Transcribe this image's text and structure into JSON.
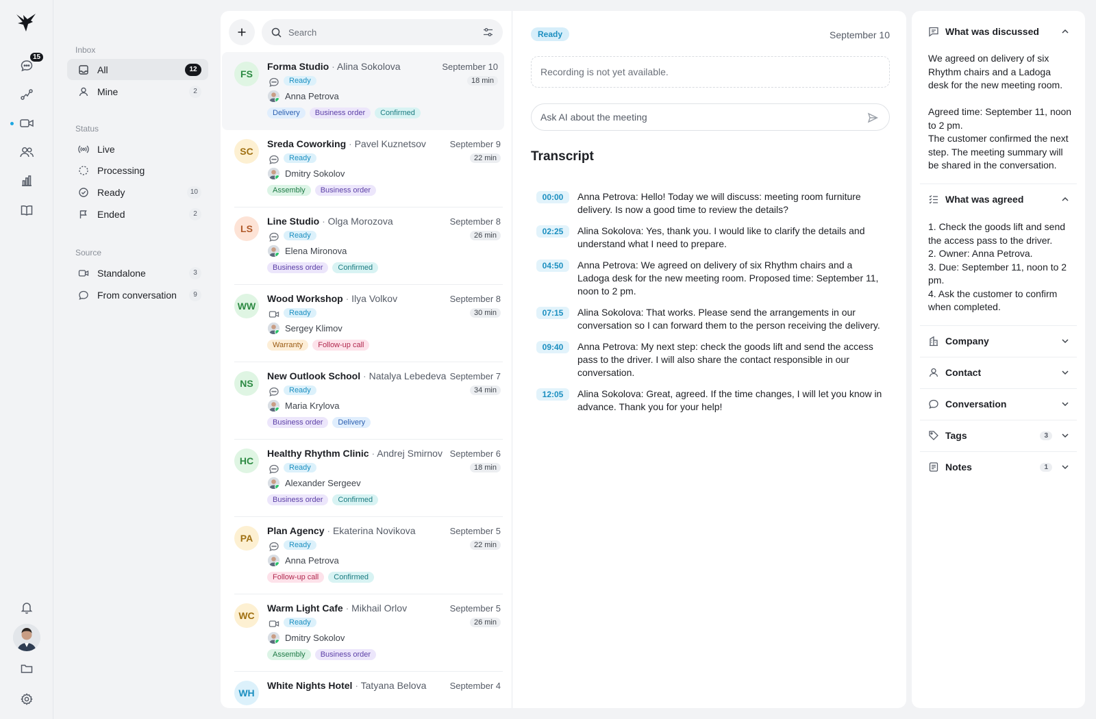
{
  "rail": {
    "chat_badge": "15"
  },
  "filters": {
    "inbox_title": "Inbox",
    "status_title": "Status",
    "source_title": "Source",
    "inbox": [
      {
        "label": "All",
        "count": "12"
      },
      {
        "label": "Mine",
        "count": "2"
      }
    ],
    "status": [
      {
        "label": "Live",
        "count": ""
      },
      {
        "label": "Processing",
        "count": ""
      },
      {
        "label": "Ready",
        "count": "10"
      },
      {
        "label": "Ended",
        "count": "2"
      }
    ],
    "source": [
      {
        "label": "Standalone",
        "count": "3"
      },
      {
        "label": "From conversation",
        "count": "9"
      }
    ]
  },
  "search": {
    "placeholder": "Search"
  },
  "meetings": [
    {
      "initials": "FS",
      "company": "Forma Studio",
      "contact": "Alina Sokolova",
      "date": "September 10",
      "duration": "18 min",
      "status": "Ready",
      "agent": "Anna Petrova",
      "source": "chat",
      "tags": [
        "Delivery",
        "Business order",
        "Confirmed"
      ]
    },
    {
      "initials": "SC",
      "company": "Sreda Coworking",
      "contact": "Pavel Kuznetsov",
      "date": "September 9",
      "duration": "22 min",
      "status": "Ready",
      "agent": "Dmitry Sokolov",
      "source": "chat",
      "tags": [
        "Assembly",
        "Business order"
      ]
    },
    {
      "initials": "LS",
      "company": "Line Studio",
      "contact": "Olga Morozova",
      "date": "September 8",
      "duration": "26 min",
      "status": "Ready",
      "agent": "Elena Mironova",
      "source": "chat",
      "tags": [
        "Business order",
        "Confirmed"
      ]
    },
    {
      "initials": "WW",
      "company": "Wood Workshop",
      "contact": "Ilya Volkov",
      "date": "September 8",
      "duration": "30 min",
      "status": "Ready",
      "agent": "Sergey Klimov",
      "source": "video",
      "tags": [
        "Warranty",
        "Follow-up call"
      ]
    },
    {
      "initials": "NS",
      "company": "New Outlook School",
      "contact": "Natalya Lebedeva",
      "date": "September 7",
      "duration": "34 min",
      "status": "Ready",
      "agent": "Maria Krylova",
      "source": "chat",
      "tags": [
        "Business order",
        "Delivery"
      ]
    },
    {
      "initials": "HC",
      "company": "Healthy Rhythm Clinic",
      "contact": "Andrej Smirnov",
      "date": "September 6",
      "duration": "18 min",
      "status": "Ready",
      "agent": "Alexander Sergeev",
      "source": "chat",
      "tags": [
        "Business order",
        "Confirmed"
      ]
    },
    {
      "initials": "PA",
      "company": "Plan Agency",
      "contact": "Ekaterina Novikova",
      "date": "September 5",
      "duration": "22 min",
      "status": "Ready",
      "agent": "Anna Petrova",
      "source": "chat",
      "tags": [
        "Follow-up call",
        "Confirmed"
      ]
    },
    {
      "initials": "WC",
      "company": "Warm Light Cafe",
      "contact": "Mikhail Orlov",
      "date": "September 5",
      "duration": "26 min",
      "status": "Ready",
      "agent": "Dmitry Sokolov",
      "source": "video",
      "tags": [
        "Assembly",
        "Business order"
      ]
    },
    {
      "initials": "WH",
      "company": "White Nights Hotel",
      "contact": "Tatyana Belova",
      "date": "September 4",
      "duration": "",
      "status": "",
      "agent": "",
      "source": "",
      "tags": []
    }
  ],
  "detail": {
    "status": "Ready",
    "date": "September 10",
    "recording_note": "Recording is not yet available.",
    "ask_placeholder": "Ask AI about the meeting",
    "transcript_title": "Transcript",
    "transcript": [
      {
        "time": "00:00",
        "text": "Anna Petrova: Hello! Today we will discuss: meeting room furniture delivery. Is now a good time to review the details?"
      },
      {
        "time": "02:25",
        "text": "Alina Sokolova: Yes, thank you. I would like to clarify the details and understand what I need to prepare."
      },
      {
        "time": "04:50",
        "text": "Anna Petrova: We agreed on delivery of six Rhythm chairs and a Ladoga desk for the new meeting room. Proposed time: September 11, noon to 2 pm."
      },
      {
        "time": "07:15",
        "text": "Alina Sokolova: That works. Please send the arrangements in our conversation so I can forward them to the person receiving the delivery."
      },
      {
        "time": "09:40",
        "text": "Anna Petrova: My next step: check the goods lift and send the access pass to the driver. I will also share the contact responsible in our conversation."
      },
      {
        "time": "12:05",
        "text": "Alina Sokolova: Great, agreed. If the time changes, I will let you know in advance. Thank you for your help!"
      }
    ]
  },
  "side": {
    "discussed_title": "What was discussed",
    "discussed_body": "We agreed on delivery of six Rhythm chairs and a Ladoga desk for the new meeting room.\n\nAgreed time: September 11, noon to 2 pm.\nThe customer confirmed the next step. The meeting summary will be shared in the conversation.",
    "agreed_title": "What was agreed",
    "agreed_body": "1. Check the goods lift and send the access pass to the driver.\n2. Owner: Anna Petrova.\n3. Due: September 11, noon to 2 pm.\n4. Ask the customer to confirm when completed.",
    "company_title": "Company",
    "contact_title": "Contact",
    "conversation_title": "Conversation",
    "tags_title": "Tags",
    "tags_count": "3",
    "notes_title": "Notes",
    "notes_count": "1"
  },
  "colors": {
    "accent": "#1c8fc0",
    "accent_bg": "#dcf1fb",
    "online": "#2cc46b"
  }
}
